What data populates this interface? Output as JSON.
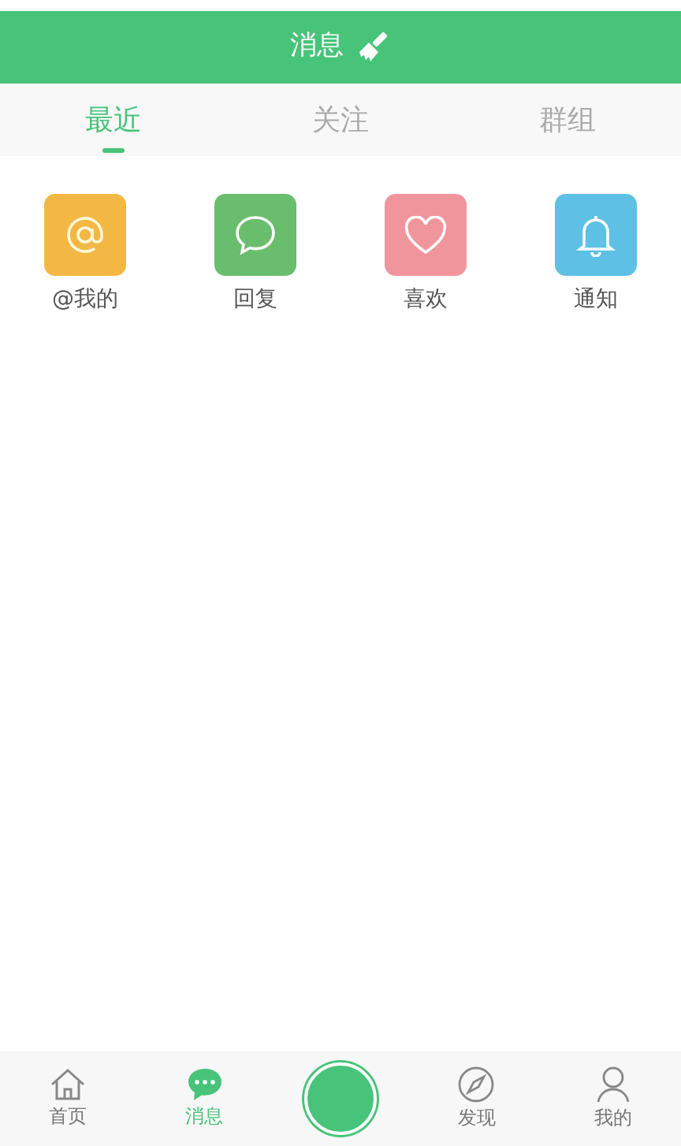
{
  "header": {
    "title": "消息"
  },
  "tabs": [
    {
      "label": "最近",
      "selected": true
    },
    {
      "label": "关注",
      "selected": false
    },
    {
      "label": "群组",
      "selected": false
    }
  ],
  "shortcuts": [
    {
      "label": "@我的",
      "kind": "at",
      "color": "#f2b843"
    },
    {
      "label": "回复",
      "kind": "comment",
      "color": "#6abd6c"
    },
    {
      "label": "喜欢",
      "kind": "heart",
      "color": "#f1959c"
    },
    {
      "label": "通知",
      "kind": "bell",
      "color": "#5dc0e4"
    }
  ],
  "bottom_nav": [
    {
      "kind": "home",
      "label": "首页",
      "selected": false
    },
    {
      "kind": "message",
      "label": "消息",
      "selected": true
    },
    {
      "kind": "publish"
    },
    {
      "kind": "compass",
      "label": "发现",
      "selected": false
    },
    {
      "kind": "person",
      "label": "我的",
      "selected": false
    }
  ]
}
